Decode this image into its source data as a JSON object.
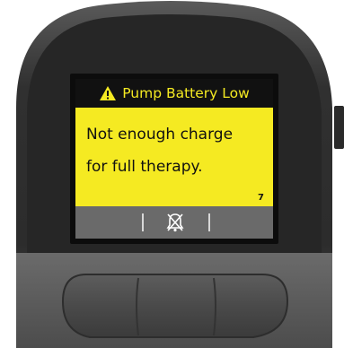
{
  "alert": {
    "title": "Pump Battery Low",
    "message_line1": "Not enough charge",
    "message_line2": "for full therapy.",
    "code": "7"
  },
  "icons": {
    "title_icon": "warning-triangle-icon",
    "softkey_icon": "sound-muted-icon"
  },
  "colors": {
    "alert_yellow": "#f5ea22",
    "title_bar": "#111111",
    "softkey_bar": "#6a6a6a",
    "device_body": "#3a3a3a"
  }
}
